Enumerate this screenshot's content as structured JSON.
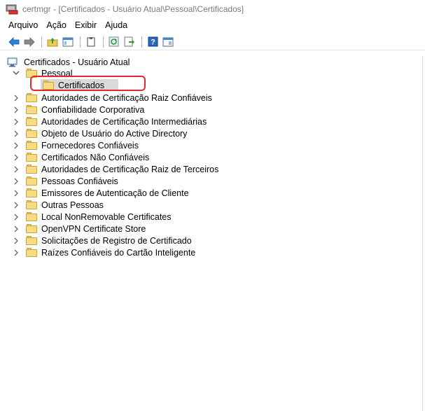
{
  "window": {
    "title": "certmgr - [Certificados - Usuário Atual\\Pessoal\\Certificados]"
  },
  "menu": {
    "items": [
      "Arquivo",
      "Ação",
      "Exibir",
      "Ajuda"
    ]
  },
  "toolbar": {
    "buttons": [
      "back-arrow-icon",
      "forward-arrow-icon",
      "up-folder-icon",
      "console-tree-icon",
      "clipboard-icon",
      "refresh-icon",
      "export-icon",
      "help-icon",
      "properties-icon"
    ]
  },
  "tree": {
    "root": "Certificados - Usuário Atual",
    "pessoal": "Pessoal",
    "selected": "Certificados",
    "items": [
      "Autoridades de Certificação Raiz Confiáveis",
      "Confiabilidade Corporativa",
      "Autoridades de Certificação Intermediárias",
      "Objeto de Usuário do Active Directory",
      "Fornecedores Confiáveis",
      "Certificados Não Confiáveis",
      "Autoridades de Certificação Raiz de Terceiros",
      "Pessoas Confiáveis",
      "Emissores de Autenticação de Cliente",
      "Outras Pessoas",
      "Local NonRemovable Certificates",
      "OpenVPN Certificate Store",
      "Solicitações de Registro de Certificado",
      "Raízes Confiáveis do Cartão Inteligente"
    ]
  },
  "colors": {
    "highlight": "#e0282e",
    "folder": "#f7dc84",
    "selected_bg": "#d9d9d9"
  }
}
